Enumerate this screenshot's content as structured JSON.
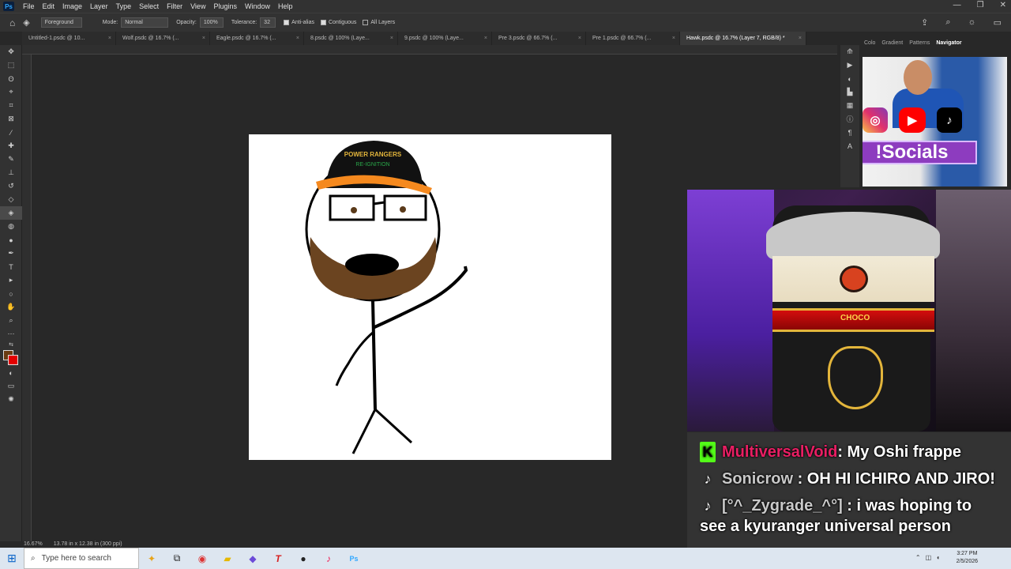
{
  "app": {
    "logo": "Ps"
  },
  "menu": [
    "File",
    "Edit",
    "Image",
    "Layer",
    "Type",
    "Select",
    "Filter",
    "View",
    "Plugins",
    "Window",
    "Help"
  ],
  "window_controls": [
    "—",
    "❐",
    "✕"
  ],
  "options_bar": {
    "fill_source": "Foreground",
    "mode_label": "Mode:",
    "mode_value": "Normal",
    "opacity_label": "Opacity:",
    "opacity_value": "100%",
    "tolerance_label": "Tolerance:",
    "tolerance_value": "32",
    "antialias_label": "Anti-alias",
    "contiguous_label": "Contiguous",
    "all_layers_label": "All Layers"
  },
  "tabs": [
    "Untitled-1.psdc @ 10...",
    "Wolf.psdc @ 16.7% (...",
    "Eagle.psdc @ 16.7% (...",
    "8.psdc @ 100% (Laye...",
    "9.psdc @ 100% (Laye...",
    "Pre 3.psdc @ 66.7% (...",
    "Pre 1.psdc @ 66.7% (...",
    "Hawk.psdc @ 16.7% (Layer 7, RGB/8) *"
  ],
  "panel_tabs": [
    "Colo",
    "Gradient",
    "Patterns",
    "Navigator"
  ],
  "canvas_art": {
    "cap_logo_line1": "POWER RANGERS",
    "cap_logo_line2": "RE-IGNITION"
  },
  "socials_overlay": {
    "label": "!Socials",
    "icons": [
      "instagram-icon",
      "youtube-icon",
      "tiktok-icon"
    ]
  },
  "frappe_overlay": {
    "band_text": "CHOCO"
  },
  "chat": [
    {
      "platform": "kick",
      "user": "MultiversalVoid",
      "message": ": My Oshi frappe"
    },
    {
      "platform": "tiktok",
      "user": "Sonicrow",
      "message": ": OH HI ICHIRO AND JIRO!"
    },
    {
      "platform": "tiktok",
      "user": "[°^_Zygrade_^°]",
      "message": ": i was hoping to see a kyuranger universal person"
    }
  ],
  "status": {
    "zoom": "16.67%",
    "doc_info": "13.78 in x 12.38 in (300 ppi)"
  },
  "taskbar": {
    "search_placeholder": "Type here to search",
    "time": "3:27 PM",
    "date": "2/5/2026"
  }
}
